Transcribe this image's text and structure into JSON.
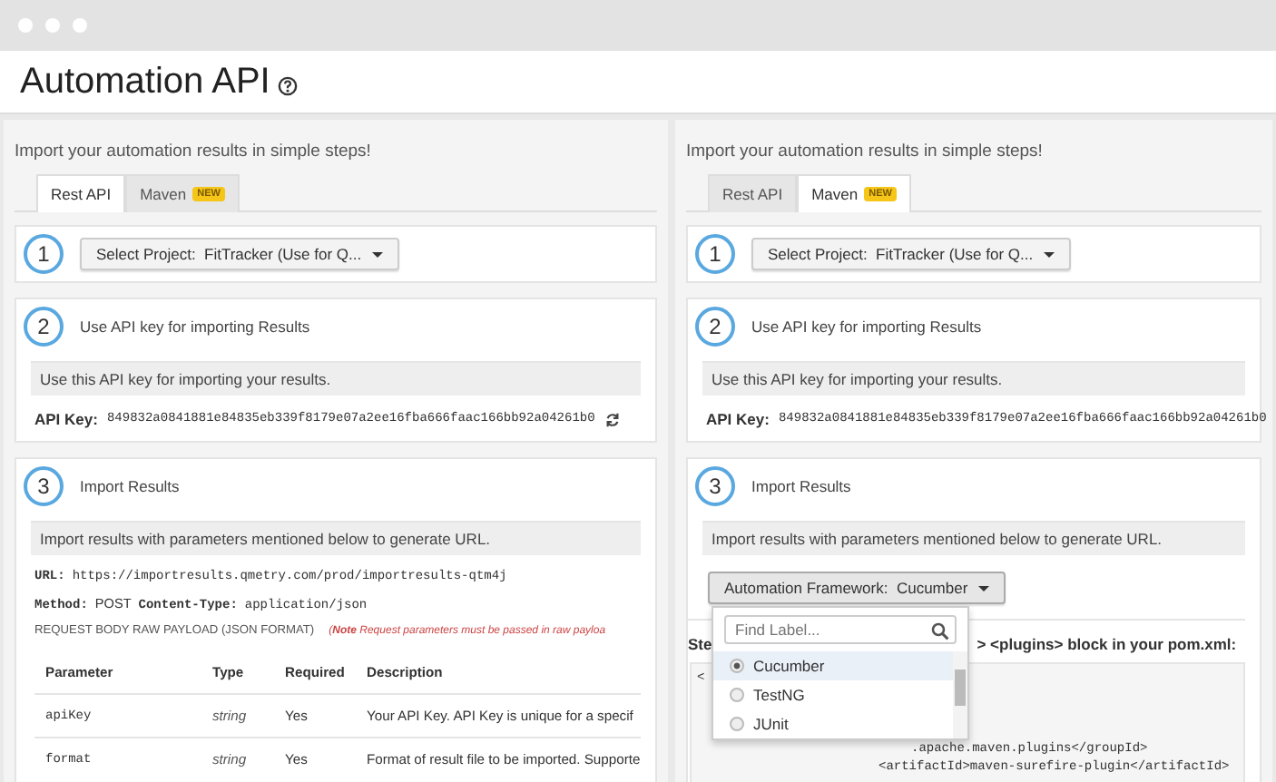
{
  "window": {
    "title": "Automation API"
  },
  "panels": [
    {
      "intro": "Import your automation results in simple steps!",
      "tabs": [
        {
          "label": "Rest API",
          "selected": true
        },
        {
          "label": "Maven",
          "badge": "NEW",
          "selected": false
        }
      ],
      "steps": [
        {
          "number": "1",
          "kind": "project",
          "label": "Select Project:",
          "value": "FitTracker (Use for Q..."
        },
        {
          "number": "2",
          "kind": "api_key",
          "title": "Use API key for importing Results",
          "info": "Use this API key for importing your results.",
          "key_label": "API Key:",
          "key": "849832a0841881e84835eb339f8179e07a2ee16fba666faac166bb92a04261b0"
        },
        {
          "number": "3",
          "kind": "rest",
          "title": "Import Results",
          "info": "Import results with parameters mentioned below to generate URL.",
          "url_label": "URL:",
          "url": "https://importresults.qmetry.com/prod/importresults-qtm4j",
          "method_label": "Method:",
          "method": "POST",
          "content_type_label": "Content-Type:",
          "content_type": "application/json",
          "payload_heading": "REQUEST BODY RAW PAYLOAD (JSON FORMAT)",
          "payload_note": "(**Note** Request parameters must be passed in raw payloa",
          "table": {
            "columns": [
              "Parameter",
              "Type",
              "Required",
              "Description"
            ],
            "rows": [
              [
                "apiKey",
                "string",
                "Yes",
                "Your API Key. API Key is unique for a specif"
              ],
              [
                "format",
                "string",
                "Yes",
                "Format of result file to be imported. Supporte"
              ]
            ]
          }
        }
      ]
    },
    {
      "intro": "Import your automation results in simple steps!",
      "tabs": [
        {
          "label": "Rest API",
          "selected": false
        },
        {
          "label": "Maven",
          "badge": "NEW",
          "selected": true
        }
      ],
      "steps": [
        {
          "number": "1",
          "kind": "project",
          "label": "Select Project:",
          "value": "FitTracker (Use for Q..."
        },
        {
          "number": "2",
          "kind": "api_key",
          "title": "Use API key for importing Results",
          "info": "Use this API key for importing your results.",
          "key_label": "API Key:",
          "key": "849832a0841881e84835eb339f8179e07a2ee16fba666faac166bb92a04261b0"
        },
        {
          "number": "3",
          "kind": "maven",
          "title": "Import Results",
          "info": "Import results with parameters mentioned below to generate URL.",
          "framework": {
            "label": "Automation Framework:",
            "value": "Cucumber",
            "expanded": true
          },
          "menu": {
            "placeholder": "Find Label...",
            "options": [
              {
                "label": "Cucumber",
                "selected": true
              },
              {
                "label": "TestNG",
                "selected": false
              },
              {
                "label": "JUnit",
                "selected": false
              }
            ]
          },
          "pom_heading_start": "Ste",
          "pom_heading_end": "> <plugins> block in your pom.xml:",
          "code_lines": [
            "<",
            ".apache.maven.plugins</groupId>",
            "<artifactId>maven-surefire-plugin</artifactId>"
          ]
        }
      ]
    }
  ]
}
